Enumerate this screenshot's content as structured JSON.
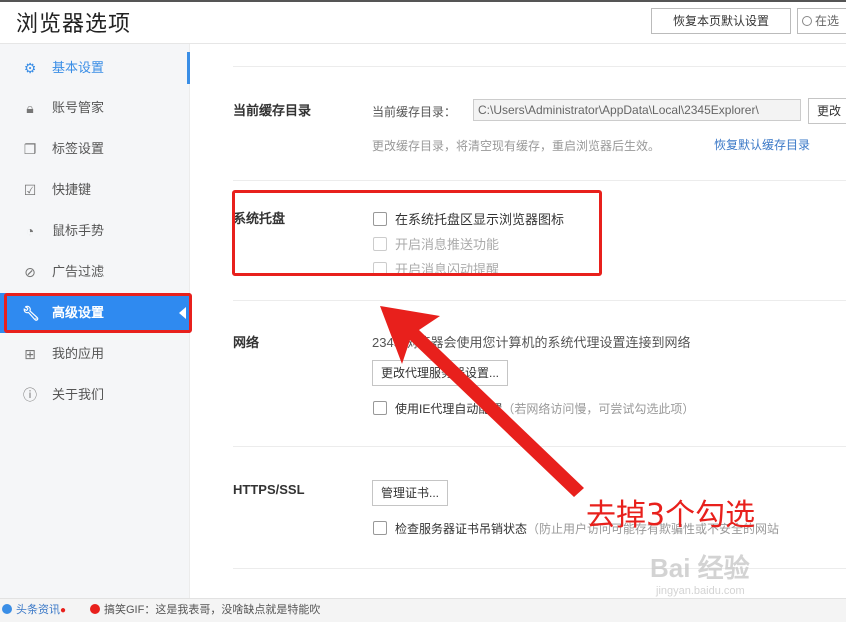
{
  "header": {
    "title": "浏览器选项",
    "restore_button": "恢复本页默认设置",
    "search_placeholder": "在选"
  },
  "sidebar": {
    "items": [
      {
        "label": "基本设置",
        "icon": "gear-icon",
        "state": "highlight"
      },
      {
        "label": "账号管家",
        "icon": "lock-icon"
      },
      {
        "label": "标签设置",
        "icon": "tabs-icon"
      },
      {
        "label": "快捷键",
        "icon": "keyboard-icon"
      },
      {
        "label": "鼠标手势",
        "icon": "mouse-icon"
      },
      {
        "label": "广告过滤",
        "icon": "block-icon"
      },
      {
        "label": "高级设置",
        "icon": "wrench-icon",
        "state": "selected"
      },
      {
        "label": "我的应用",
        "icon": "apps-icon"
      },
      {
        "label": "关于我们",
        "icon": "info-icon"
      }
    ]
  },
  "cache": {
    "section_label": "当前缓存目录",
    "field_label": "当前缓存目录：",
    "path_value": "C:\\Users\\Administrator\\AppData\\Local\\2345Explorer\\",
    "change_button": "更改",
    "hint": "更改缓存目录，将清空现有缓存，重启浏览器后生效。",
    "restore_link": "恢复默认缓存目录"
  },
  "tray": {
    "section_label": "系统托盘",
    "options": [
      {
        "label": "在系统托盘区显示浏览器图标",
        "enabled": true
      },
      {
        "label": "开启消息推送功能",
        "enabled": false
      },
      {
        "label": "开启消息闪动提醒",
        "enabled": false
      }
    ]
  },
  "network": {
    "section_label": "网络",
    "description": "2345 浏览器会使用您计算机的系统代理设置连接到网络",
    "proxy_button": "更改代理服务器设置...",
    "ie_proxy_option": "使用IE代理自动配置",
    "ie_proxy_hint": "（若网络访问慢，可尝试勾选此项）"
  },
  "https": {
    "section_label": "HTTPS/SSL",
    "cert_button": "管理证书...",
    "revocation_option": "检查服务器证书吊销状态",
    "revocation_hint": "（防止用户访问可能存有欺骗性或不安全的网站"
  },
  "annotation": {
    "text": "去掉3个勾选",
    "color": "#e8201c"
  },
  "watermark": {
    "main": "Bai 经验",
    "sub": "jingyan.baidu.com"
  },
  "statusbar": {
    "news": "头条资讯",
    "gif": "搞笑GIF：这是我表哥，没啥缺点就是特能吹"
  },
  "colors": {
    "accent": "#2f8af0",
    "annotation_red": "#e8201c",
    "link": "#3a78c7"
  }
}
